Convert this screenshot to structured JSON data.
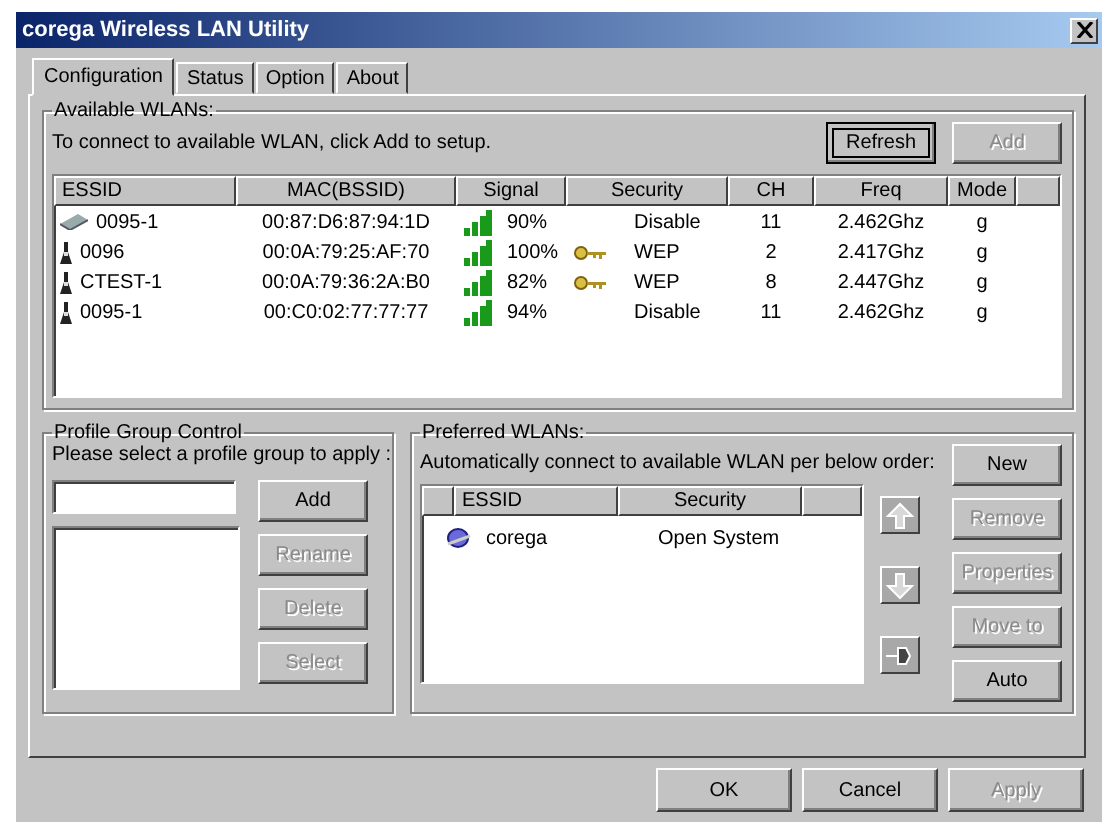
{
  "window": {
    "title": "corega Wireless LAN Utility"
  },
  "tabs": [
    {
      "label": "Configuration",
      "selected": true
    },
    {
      "label": "Status",
      "selected": false
    },
    {
      "label": "Option",
      "selected": false
    },
    {
      "label": "About",
      "selected": false
    }
  ],
  "available": {
    "title": "Available WLANs:",
    "hint": "To connect to available WLAN, click Add to setup.",
    "buttons": [
      {
        "label": "Refresh",
        "disabled": false,
        "focused": true
      },
      {
        "label": "Add",
        "disabled": true,
        "focused": false
      }
    ],
    "columns": [
      "ESSID",
      "MAC(BSSID)",
      "Signal",
      "Security",
      "CH",
      "Freq",
      "Mode"
    ],
    "rows": [
      {
        "kind": "card",
        "essid": "0095-1",
        "mac": "00:87:D6:87:94:1D",
        "signal": "90%",
        "key": false,
        "security": "Disable",
        "ch": "11",
        "freq": "2.462Ghz",
        "mode": "g"
      },
      {
        "kind": "tower",
        "essid": "0096",
        "mac": "00:0A:79:25:AF:70",
        "signal": "100%",
        "key": true,
        "security": "WEP",
        "ch": "2",
        "freq": "2.417Ghz",
        "mode": "g"
      },
      {
        "kind": "tower",
        "essid": "CTEST-1",
        "mac": "00:0A:79:36:2A:B0",
        "signal": "82%",
        "key": true,
        "security": "WEP",
        "ch": "8",
        "freq": "2.447Ghz",
        "mode": "g"
      },
      {
        "kind": "tower",
        "essid": "0095-1",
        "mac": "00:C0:02:77:77:77",
        "signal": "94%",
        "key": false,
        "security": "Disable",
        "ch": "11",
        "freq": "2.462Ghz",
        "mode": "g"
      }
    ]
  },
  "profile": {
    "title": "Profile Group Control",
    "hint": "Please select a profile group to apply :",
    "buttons": [
      {
        "label": "Add",
        "disabled": false
      },
      {
        "label": "Rename",
        "disabled": true
      },
      {
        "label": "Delete",
        "disabled": true
      },
      {
        "label": "Select",
        "disabled": true
      }
    ]
  },
  "preferred": {
    "title": "Preferred WLANs:",
    "hint": "Automatically connect to available WLAN per below order:",
    "columns": [
      "ESSID",
      "Security"
    ],
    "rows": [
      {
        "essid": "corega",
        "security": "Open System"
      }
    ],
    "buttons": [
      {
        "label": "New",
        "disabled": false
      },
      {
        "label": "Remove",
        "disabled": true
      },
      {
        "label": "Properties",
        "disabled": true
      },
      {
        "label": "Move to",
        "disabled": true
      },
      {
        "label": "Auto",
        "disabled": false
      }
    ]
  },
  "footer": [
    {
      "label": "OK",
      "disabled": false
    },
    {
      "label": "Cancel",
      "disabled": false
    },
    {
      "label": "Apply",
      "disabled": true
    }
  ]
}
